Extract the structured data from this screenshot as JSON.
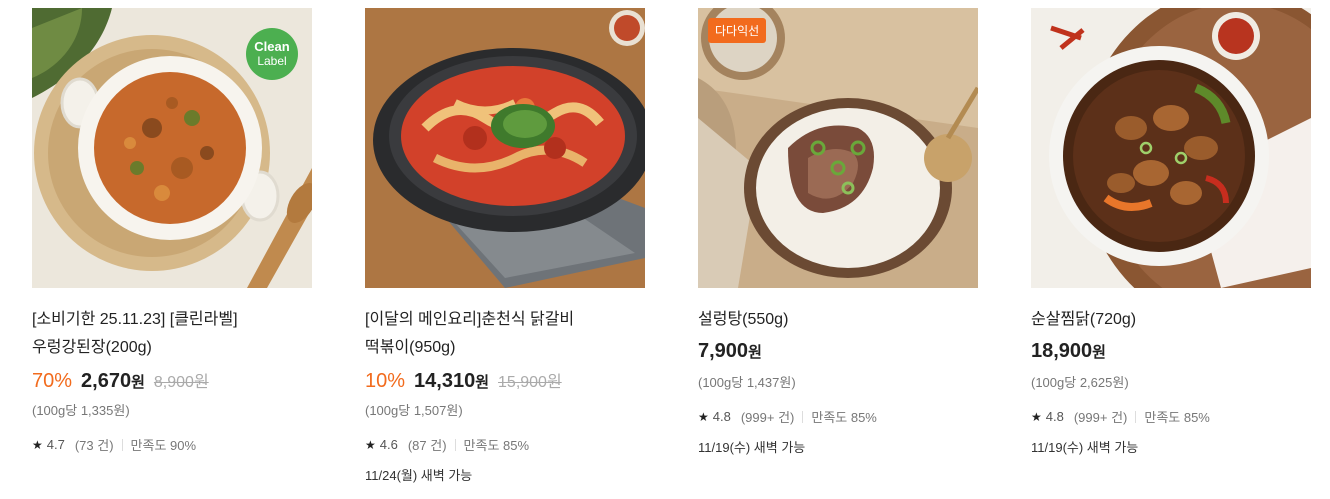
{
  "products": [
    {
      "title_line1": "[소비기한 25.11.23] [클린라벨]",
      "title_line2": "우렁강된장(200g)",
      "badge_line1": "Clean",
      "badge_line2": "Label",
      "discount": "70%",
      "price": "2,670",
      "currency": "원",
      "original_price": "8,900원",
      "unit_price": "(100g당 1,335원)",
      "rating": "4.7",
      "review_count": "(73 건)",
      "satisfaction": "만족도 90%",
      "delivery": ""
    },
    {
      "title_line1": "[이달의 메인요리]춘천식 닭갈비",
      "title_line2": "떡볶이(950g)",
      "discount": "10%",
      "price": "14,310",
      "currency": "원",
      "original_price": "15,900원",
      "unit_price": "(100g당 1,507원)",
      "rating": "4.6",
      "review_count": "(87 건)",
      "satisfaction": "만족도 85%",
      "delivery": "11/24(월) 새벽 가능"
    },
    {
      "title_line1": "설렁탕(550g)",
      "badge": "다다익선",
      "price": "7,900",
      "currency": "원",
      "unit_price": "(100g당 1,437원)",
      "rating": "4.8",
      "review_count": "(999+ 건)",
      "satisfaction": "만족도 85%",
      "delivery": "11/19(수) 새벽 가능"
    },
    {
      "title_line1": "순살찜닭(720g)",
      "price": "18,900",
      "currency": "원",
      "unit_price": "(100g당 2,625원)",
      "rating": "4.8",
      "review_count": "(999+ 건)",
      "satisfaction": "만족도 85%",
      "delivery": "11/19(수) 새벽 가능"
    }
  ],
  "colors": {
    "accent": "#f26b1d",
    "clean_label": "#4caf50",
    "strike": "#aaaaaa"
  },
  "icons": {
    "star": "star-icon"
  }
}
